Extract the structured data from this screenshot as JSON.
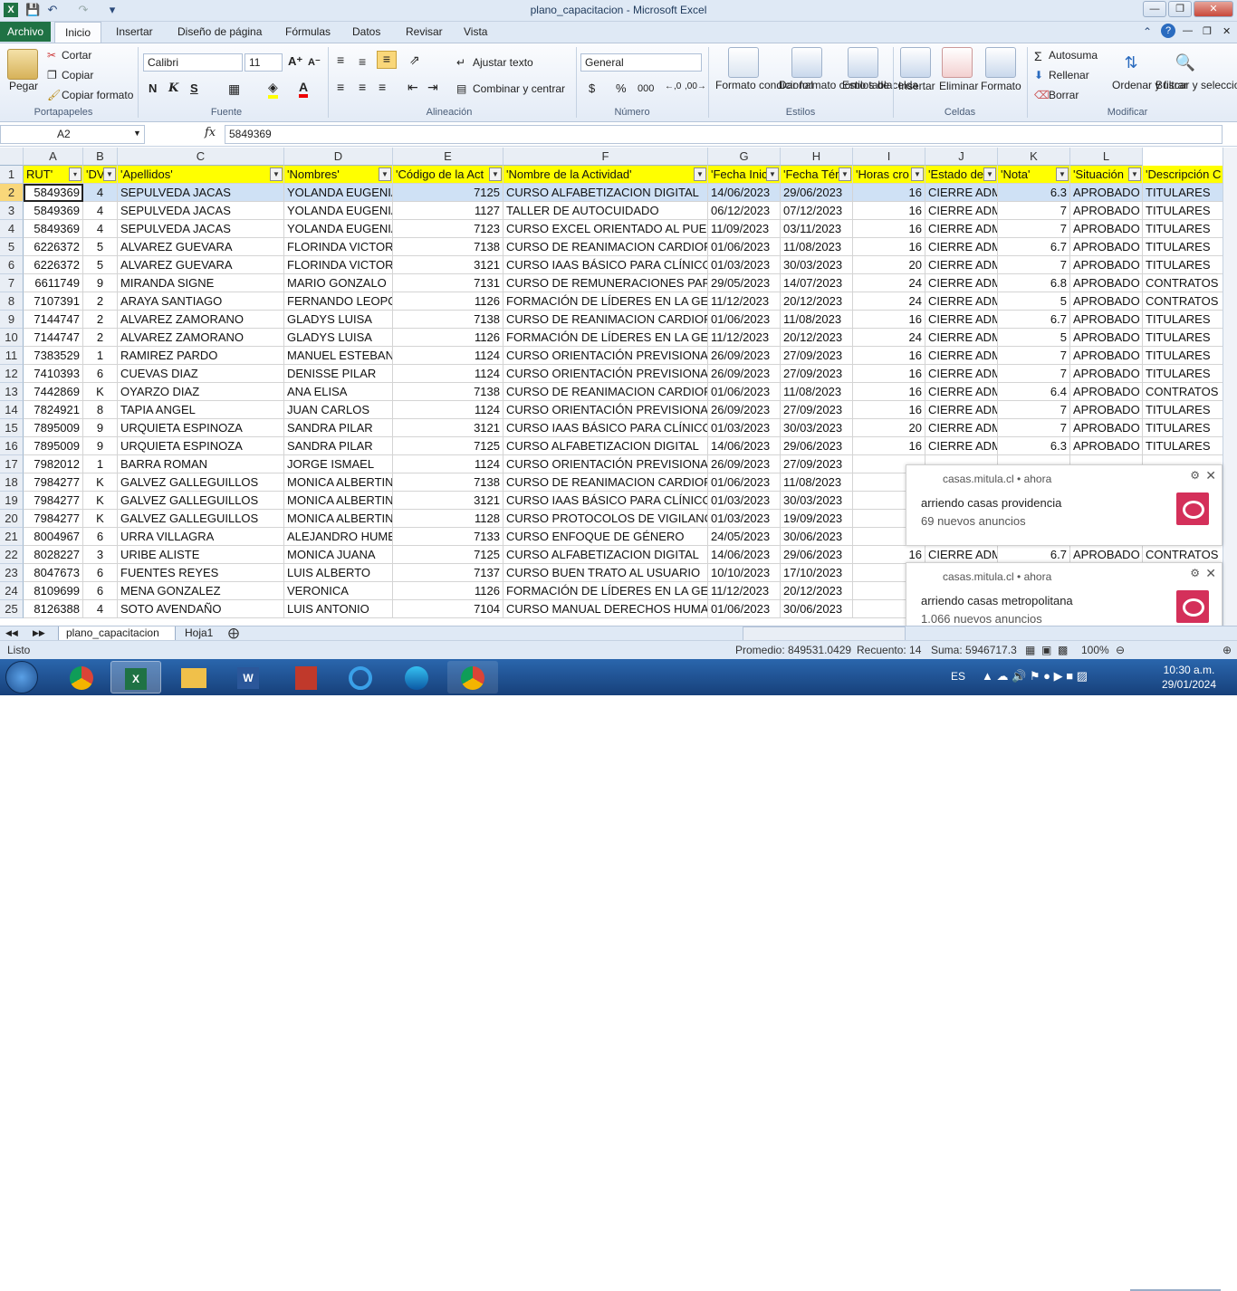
{
  "window": {
    "title": "plano_capacitacion  -  Microsoft Excel"
  },
  "ribbon_tabs": [
    "Archivo",
    "Inicio",
    "Insertar",
    "Diseño de página",
    "Fórmulas",
    "Datos",
    "Revisar",
    "Vista"
  ],
  "ribbon": {
    "clipboard": {
      "paste": "Pegar",
      "cut": "Cortar",
      "copy": "Copiar",
      "format_painter": "Copiar formato",
      "group": "Portapapeles"
    },
    "font": {
      "name": "Calibri",
      "size": "11",
      "group": "Fuente",
      "bold": "N",
      "italic": "K",
      "underline": "S"
    },
    "alignment": {
      "wrap": "Ajustar texto",
      "merge": "Combinar y centrar",
      "group": "Alineación"
    },
    "number": {
      "format": "General",
      "currency": "$",
      "percent": "%",
      "thousands": "000",
      "group": "Número"
    },
    "styles": {
      "conditional": "Formato condicional",
      "table": "Dar formato como tabla",
      "cell_styles": "Estilos de celda",
      "group": "Estilos"
    },
    "cells": {
      "insert": "Insertar",
      "delete": "Eliminar",
      "format": "Formato",
      "group": "Celdas"
    },
    "editing": {
      "autosum": "Autosuma",
      "fill": "Rellenar",
      "clear": "Borrar",
      "sort": "Ordenar y filtrar",
      "find": "Buscar y seleccionar",
      "group": "Modificar"
    }
  },
  "formula_bar": {
    "name_box": "A2",
    "fx": "fx",
    "value": "5849369"
  },
  "columns": [
    "A",
    "B",
    "C",
    "D",
    "E",
    "F",
    "G",
    "H",
    "I",
    "J",
    "K",
    "L"
  ],
  "headers": [
    "RUT'",
    "'DV",
    "'Apellidos'",
    "'Nombres'",
    "'Código de la Act",
    "'Nombre de la Actividad'",
    "'Fecha Inic",
    "'Fecha Tér",
    "'Horas cro",
    "'Estado de",
    "'Nota'",
    "'Situación",
    "'Descripción C"
  ],
  "row_numbers": [
    "1",
    "2",
    "3",
    "4",
    "5",
    "6",
    "7",
    "8",
    "9",
    "10",
    "11",
    "12",
    "13",
    "14",
    "15",
    "16",
    "17",
    "18",
    "19",
    "20",
    "21",
    "22",
    "23",
    "24",
    "25"
  ],
  "rows": [
    [
      "5849369",
      "4",
      "SEPULVEDA JACAS",
      "YOLANDA EUGENIA",
      "7125",
      "CURSO ALFABETIZACION DIGITAL",
      "14/06/2023",
      "29/06/2023",
      "16",
      "CIERRE ADMI",
      "6.3",
      "APROBADO",
      "TITULARES"
    ],
    [
      "5849369",
      "4",
      "SEPULVEDA JACAS",
      "YOLANDA EUGENIA",
      "1127",
      "TALLER DE AUTOCUIDADO",
      "06/12/2023",
      "07/12/2023",
      "16",
      "CIERRE ADMI",
      "7",
      "APROBADO",
      "TITULARES"
    ],
    [
      "5849369",
      "4",
      "SEPULVEDA JACAS",
      "YOLANDA EUGENIA",
      "7123",
      "CURSO EXCEL ORIENTADO AL PUESTO",
      "11/09/2023",
      "03/11/2023",
      "16",
      "CIERRE ADMI",
      "7",
      "APROBADO",
      "TITULARES"
    ],
    [
      "6226372",
      "5",
      "ALVAREZ GUEVARA",
      "FLORINDA VICTORI",
      "7138",
      "CURSO DE REANIMACION CARDIOPU",
      "01/06/2023",
      "11/08/2023",
      "16",
      "CIERRE ADMI",
      "6.7",
      "APROBADO",
      "TITULARES"
    ],
    [
      "6226372",
      "5",
      "ALVAREZ GUEVARA",
      "FLORINDA VICTORI",
      "3121",
      "CURSO IAAS BÁSICO PARA CLÍNICOS",
      "01/03/2023",
      "30/03/2023",
      "20",
      "CIERRE ADMI",
      "7",
      "APROBADO",
      "TITULARES"
    ],
    [
      "6611749",
      "9",
      "MIRANDA SIGNE",
      "MARIO GONZALO",
      "7131",
      "CURSO DE REMUNERACIONES PARA S",
      "29/05/2023",
      "14/07/2023",
      "24",
      "CIERRE ADMI",
      "6.8",
      "APROBADO",
      "CONTRATOS"
    ],
    [
      "7107391",
      "2",
      "ARAYA SANTIAGO",
      "FERNANDO LEOPO",
      "1126",
      "FORMACIÓN DE LÍDERES EN LA GESTI",
      "11/12/2023",
      "20/12/2023",
      "24",
      "CIERRE ADMI",
      "5",
      "APROBADO",
      "CONTRATOS"
    ],
    [
      "7144747",
      "2",
      "ALVAREZ ZAMORANO",
      "GLADYS LUISA",
      "7138",
      "CURSO DE REANIMACION CARDIOPU",
      "01/06/2023",
      "11/08/2023",
      "16",
      "CIERRE ADMI",
      "6.7",
      "APROBADO",
      "TITULARES"
    ],
    [
      "7144747",
      "2",
      "ALVAREZ ZAMORANO",
      "GLADYS LUISA",
      "1126",
      "FORMACIÓN DE LÍDERES EN LA GESTI",
      "11/12/2023",
      "20/12/2023",
      "24",
      "CIERRE ADMI",
      "5",
      "APROBADO",
      "TITULARES"
    ],
    [
      "7383529",
      "1",
      "RAMIREZ PARDO",
      "MANUEL ESTEBAN",
      "1124",
      "CURSO ORIENTACIÓN PREVISIONAL I",
      "26/09/2023",
      "27/09/2023",
      "16",
      "CIERRE ADMI",
      "7",
      "APROBADO",
      "TITULARES"
    ],
    [
      "7410393",
      "6",
      "CUEVAS DIAZ",
      "DENISSE PILAR",
      "1124",
      "CURSO ORIENTACIÓN PREVISIONAL I",
      "26/09/2023",
      "27/09/2023",
      "16",
      "CIERRE ADMI",
      "7",
      "APROBADO",
      "TITULARES"
    ],
    [
      "7442869",
      "K",
      "OYARZO DIAZ",
      "ANA ELISA",
      "7138",
      "CURSO DE REANIMACION CARDIOPU",
      "01/06/2023",
      "11/08/2023",
      "16",
      "CIERRE ADMI",
      "6.4",
      "APROBADO",
      "CONTRATOS"
    ],
    [
      "7824921",
      "8",
      "TAPIA ANGEL",
      "JUAN CARLOS",
      "1124",
      "CURSO ORIENTACIÓN PREVISIONAL I",
      "26/09/2023",
      "27/09/2023",
      "16",
      "CIERRE ADMI",
      "7",
      "APROBADO",
      "TITULARES"
    ],
    [
      "7895009",
      "9",
      "URQUIETA ESPINOZA",
      "SANDRA PILAR",
      "3121",
      "CURSO IAAS BÁSICO PARA CLÍNICOS",
      "01/03/2023",
      "30/03/2023",
      "20",
      "CIERRE ADMI",
      "7",
      "APROBADO",
      "TITULARES"
    ],
    [
      "7895009",
      "9",
      "URQUIETA ESPINOZA",
      "SANDRA PILAR",
      "7125",
      "CURSO ALFABETIZACION DIGITAL",
      "14/06/2023",
      "29/06/2023",
      "16",
      "CIERRE ADMI",
      "6.3",
      "APROBADO",
      "TITULARES"
    ],
    [
      "7982012",
      "1",
      "BARRA ROMAN",
      "JORGE ISMAEL",
      "1124",
      "CURSO ORIENTACIÓN PREVISIONAL I",
      "26/09/2023",
      "27/09/2023",
      "",
      "",
      "",
      "",
      ""
    ],
    [
      "7984277",
      "K",
      "GALVEZ GALLEGUILLOS",
      "MONICA ALBERTIN",
      "7138",
      "CURSO DE REANIMACION CARDIOPU",
      "01/06/2023",
      "11/08/2023",
      "",
      "",
      "",
      "",
      ""
    ],
    [
      "7984277",
      "K",
      "GALVEZ GALLEGUILLOS",
      "MONICA ALBERTIN",
      "3121",
      "CURSO IAAS BÁSICO PARA CLÍNICOS",
      "01/03/2023",
      "30/03/2023",
      "",
      "",
      "",
      "",
      ""
    ],
    [
      "7984277",
      "K",
      "GALVEZ GALLEGUILLOS",
      "MONICA ALBERTIN",
      "1128",
      "CURSO PROTOCOLOS DE VIGILANCIA",
      "01/03/2023",
      "19/09/2023",
      "",
      "",
      "",
      "",
      ""
    ],
    [
      "8004967",
      "6",
      "URRA VILLAGRA",
      "ALEJANDRO HUMB",
      "7133",
      "CURSO ENFOQUE DE GÉNERO",
      "24/05/2023",
      "30/06/2023",
      "",
      "",
      "",
      "",
      ""
    ],
    [
      "8028227",
      "3",
      "URIBE ALISTE",
      "MONICA JUANA",
      "7125",
      "CURSO ALFABETIZACION DIGITAL",
      "14/06/2023",
      "29/06/2023",
      "16",
      "CIERRE ADMI",
      "6.7",
      "APROBADO",
      "CONTRATOS"
    ],
    [
      "8047673",
      "6",
      "FUENTES REYES",
      "LUIS ALBERTO",
      "7137",
      "CURSO BUEN TRATO AL USUARIO",
      "10/10/2023",
      "17/10/2023",
      "",
      "",
      "",
      "",
      ""
    ],
    [
      "8109699",
      "6",
      "MENA GONZALEZ",
      "VERONICA",
      "1126",
      "FORMACIÓN DE LÍDERES EN LA GESTI",
      "11/12/2023",
      "20/12/2023",
      "",
      "",
      "",
      "",
      ""
    ],
    [
      "8126388",
      "4",
      "SOTO AVENDAÑO",
      "LUIS ANTONIO",
      "7104",
      "CURSO MANUAL DERECHOS HUMANO",
      "01/06/2023",
      "30/06/2023",
      "",
      "",
      "",
      "",
      ""
    ]
  ],
  "sheets": [
    "plano_capacitacion",
    "Hoja1"
  ],
  "status": {
    "ready": "Listo",
    "average": "Promedio: 849531.0429",
    "count": "Recuento: 14",
    "sum": "Suma: 5946717.3",
    "zoom": "100%"
  },
  "notifications": [
    {
      "source": "casas.mitula.cl",
      "time": "ahora",
      "title": "arriendo casas providencia",
      "body": "69 nuevos anuncios"
    },
    {
      "source": "casas.mitula.cl",
      "time": "ahora",
      "title": "arriendo casas metropolitana",
      "body": "1.066 nuevos anuncios"
    }
  ],
  "taskbar": {
    "lang": "ES",
    "time": "10:30 a.m.",
    "date": "29/01/2024"
  },
  "colors": {
    "excel_green": "#1f7244",
    "header_yellow": "#ffff00",
    "selection": "#cfe1f5",
    "ribbon": "#dfe9f5",
    "taskbar": "#1d4e8f"
  }
}
